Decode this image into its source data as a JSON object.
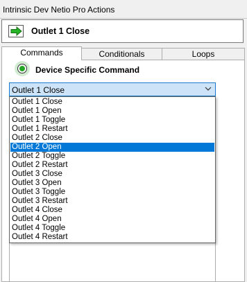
{
  "window": {
    "title": "Intrinsic Dev Netio Pro Actions"
  },
  "action": {
    "title": "Outlet 1 Close",
    "icon": "green-right-arrow-icon"
  },
  "tabs": [
    {
      "label": "Commands",
      "active": true
    },
    {
      "label": "Conditionals",
      "active": false
    },
    {
      "label": "Loops",
      "active": false
    }
  ],
  "radio": {
    "label": "Device Specific Command",
    "checked": true,
    "color": "#22a822"
  },
  "combo": {
    "selected": "Outlet 1 Close",
    "chevron": "chevron-down-icon"
  },
  "dropdown": {
    "highlighted_index": 5,
    "options": [
      "Outlet 1 Close",
      "Outlet 1 Open",
      "Outlet 1 Toggle",
      "Outlet 1 Restart",
      "Outlet 2 Close",
      "Outlet 2 Open",
      "Outlet 2 Toggle",
      "Outlet 2 Restart",
      "Outlet 3 Close",
      "Outlet 3 Open",
      "Outlet 3 Toggle",
      "Outlet 3 Restart",
      "Outlet 4 Close",
      "Outlet 4 Open",
      "Outlet 4 Toggle",
      "Outlet 4 Restart"
    ]
  },
  "colors": {
    "highlight": "#0078d7",
    "combo_bg": "#cde3f7"
  }
}
